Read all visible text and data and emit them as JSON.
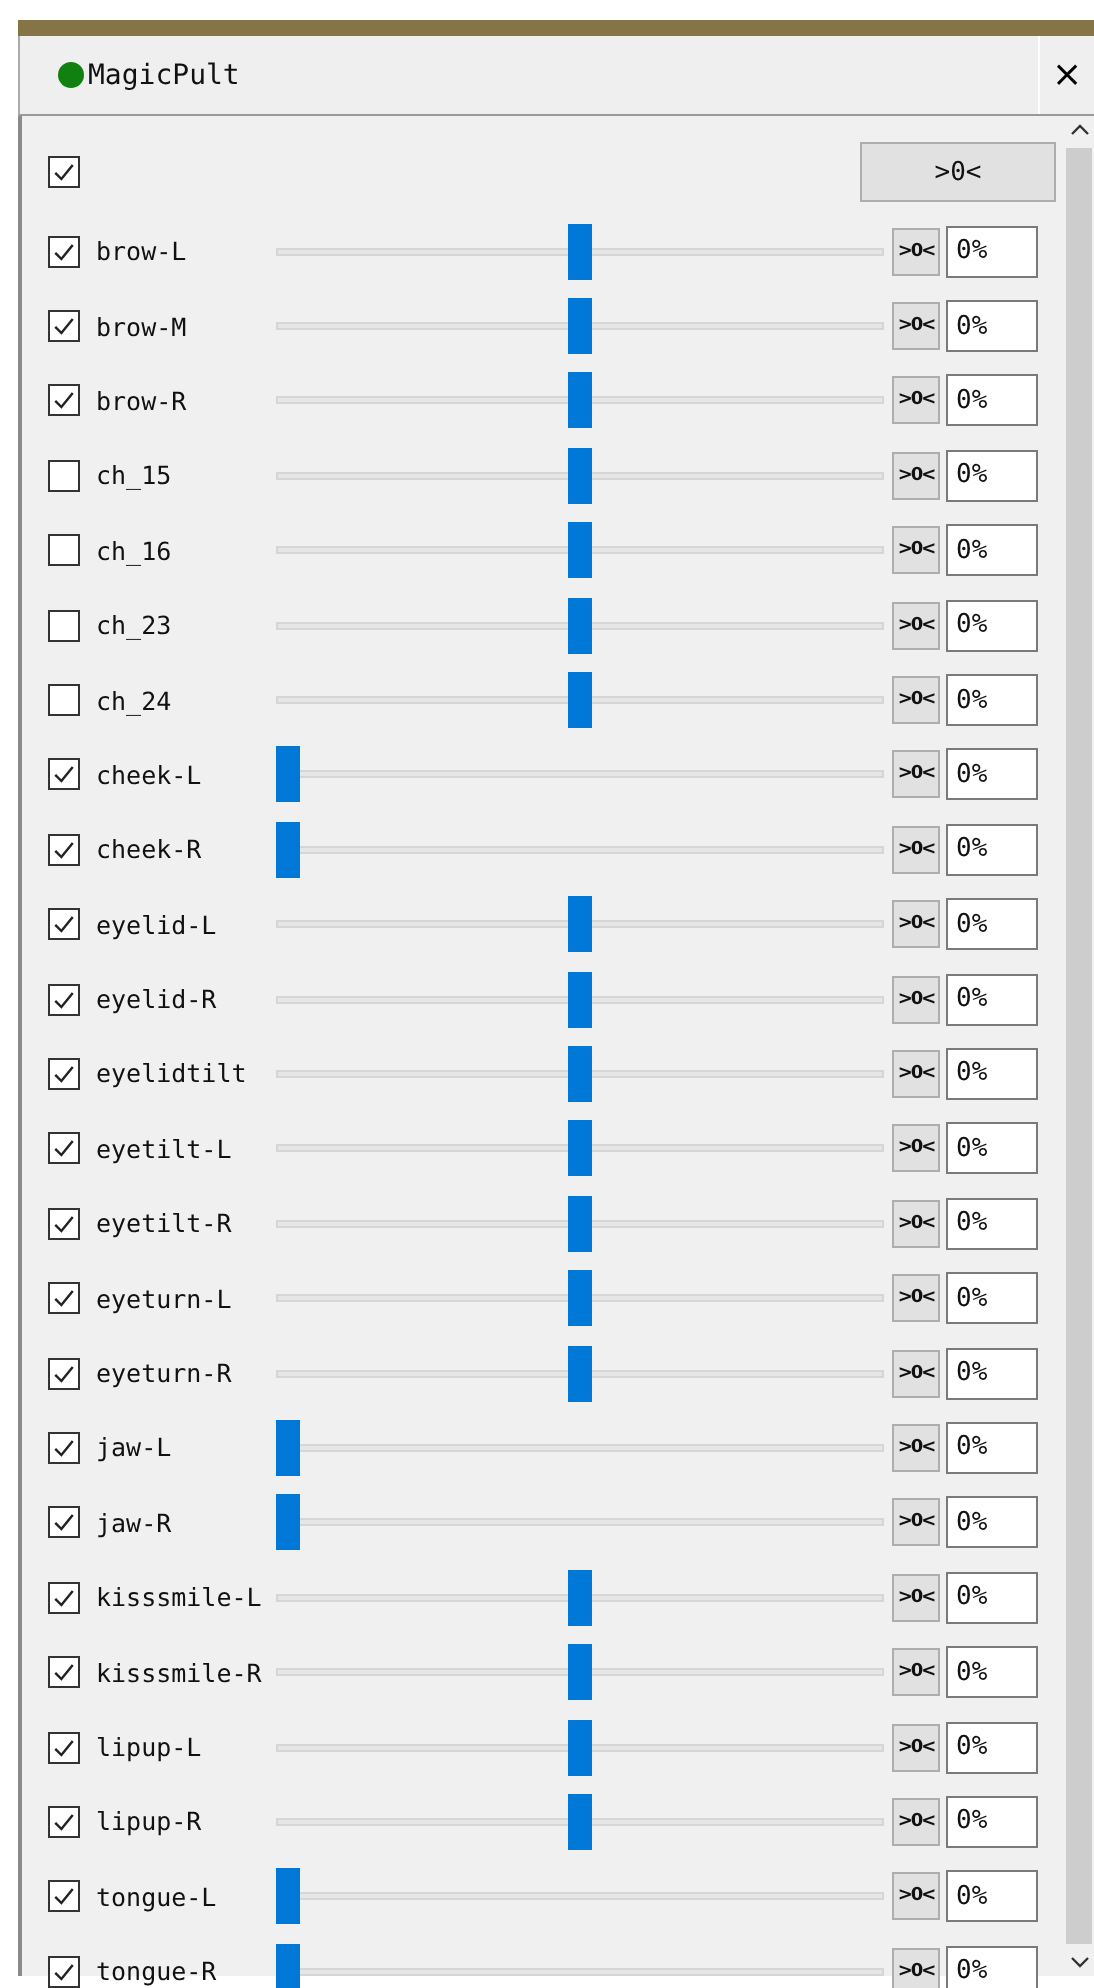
{
  "window": {
    "title": "MagicPult",
    "close": "×"
  },
  "header": {
    "checked": true,
    "reset_label": ">0<"
  },
  "channels": [
    {
      "name": "brow-L",
      "checked": true,
      "level": 0.5,
      "reset": ">0<",
      "value": "0%"
    },
    {
      "name": "brow-M",
      "checked": true,
      "level": 0.5,
      "reset": ">0<",
      "value": "0%"
    },
    {
      "name": "brow-R",
      "checked": true,
      "level": 0.5,
      "reset": ">0<",
      "value": "0%"
    },
    {
      "name": "ch_15",
      "checked": false,
      "level": 0.5,
      "reset": ">0<",
      "value": "0%"
    },
    {
      "name": "ch_16",
      "checked": false,
      "level": 0.5,
      "reset": ">0<",
      "value": "0%"
    },
    {
      "name": "ch_23",
      "checked": false,
      "level": 0.5,
      "reset": ">0<",
      "value": "0%"
    },
    {
      "name": "ch_24",
      "checked": false,
      "level": 0.5,
      "reset": ">0<",
      "value": "0%"
    },
    {
      "name": "cheek-L",
      "checked": true,
      "level": 0,
      "reset": ">0<",
      "value": "0%"
    },
    {
      "name": "cheek-R",
      "checked": true,
      "level": 0,
      "reset": ">0<",
      "value": "0%"
    },
    {
      "name": "eyelid-L",
      "checked": true,
      "level": 0.5,
      "reset": ">0<",
      "value": "0%"
    },
    {
      "name": "eyelid-R",
      "checked": true,
      "level": 0.5,
      "reset": ">0<",
      "value": "0%"
    },
    {
      "name": "eyelidtilt",
      "checked": true,
      "level": 0.5,
      "reset": ">0<",
      "value": "0%"
    },
    {
      "name": "eyetilt-L",
      "checked": true,
      "level": 0.5,
      "reset": ">0<",
      "value": "0%"
    },
    {
      "name": "eyetilt-R",
      "checked": true,
      "level": 0.5,
      "reset": ">0<",
      "value": "0%"
    },
    {
      "name": "eyeturn-L",
      "checked": true,
      "level": 0.5,
      "reset": ">0<",
      "value": "0%"
    },
    {
      "name": "eyeturn-R",
      "checked": true,
      "level": 0.5,
      "reset": ">0<",
      "value": "0%"
    },
    {
      "name": "jaw-L",
      "checked": true,
      "level": 0,
      "reset": ">0<",
      "value": "0%"
    },
    {
      "name": "jaw-R",
      "checked": true,
      "level": 0,
      "reset": ">0<",
      "value": "0%"
    },
    {
      "name": "kisssmile-L",
      "checked": true,
      "level": 0.5,
      "reset": ">0<",
      "value": "0%"
    },
    {
      "name": "kisssmile-R",
      "checked": true,
      "level": 0.5,
      "reset": ">0<",
      "value": "0%"
    },
    {
      "name": "lipup-L",
      "checked": true,
      "level": 0.5,
      "reset": ">0<",
      "value": "0%"
    },
    {
      "name": "lipup-R",
      "checked": true,
      "level": 0.5,
      "reset": ">0<",
      "value": "0%"
    },
    {
      "name": "tongue-L",
      "checked": true,
      "level": 0,
      "reset": ">0<",
      "value": "0%"
    },
    {
      "name": "tongue-R",
      "checked": true,
      "level": 0,
      "reset": ">0<",
      "value": "0%"
    }
  ]
}
